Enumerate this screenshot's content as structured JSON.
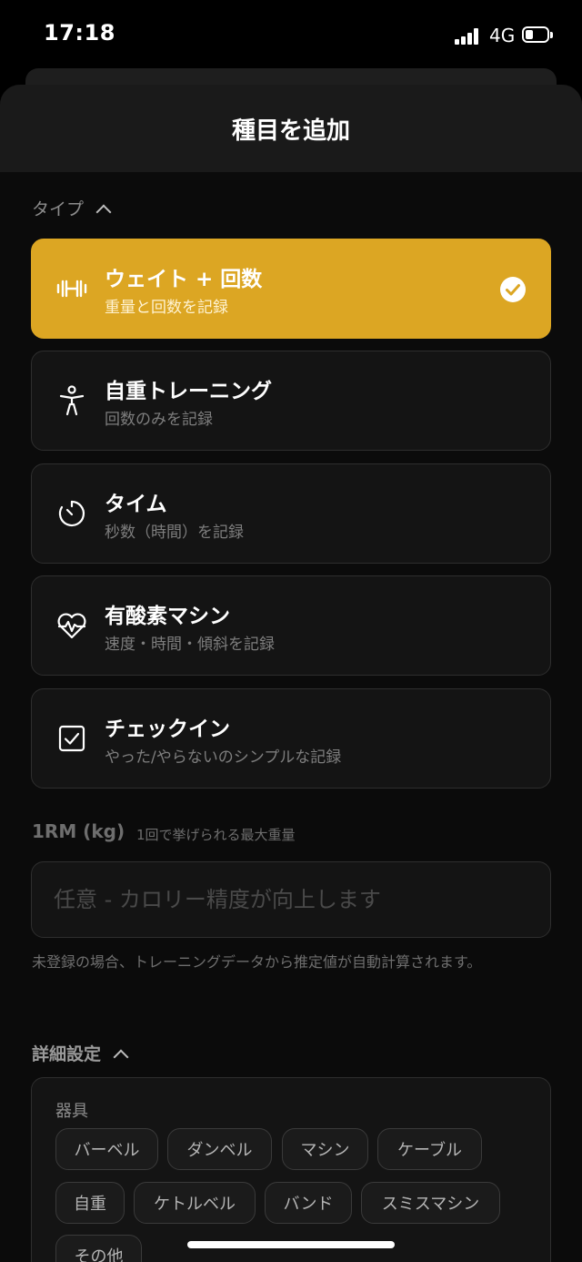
{
  "status": {
    "time": "17:18",
    "network": "4G"
  },
  "sheet": {
    "title": "種目を追加"
  },
  "type_section": {
    "label": "タイプ",
    "options": [
      {
        "title": "ウェイト + 回数",
        "description": "重量と回数を記録",
        "icon": "dumbbell-icon",
        "selected": true
      },
      {
        "title": "自重トレーニング",
        "description": "回数のみを記録",
        "icon": "person-icon",
        "selected": false
      },
      {
        "title": "タイム",
        "description": "秒数（時間）を記録",
        "icon": "timer-icon",
        "selected": false
      },
      {
        "title": "有酸素マシン",
        "description": "速度・時間・傾斜を記録",
        "icon": "heart-pulse-icon",
        "selected": false
      },
      {
        "title": "チェックイン",
        "description": "やった/やらないのシンプルな記録",
        "icon": "checkbox-icon",
        "selected": false
      }
    ]
  },
  "one_rm": {
    "label": "1RM (kg)",
    "sublabel": "1回で挙げられる最大重量",
    "value": "",
    "placeholder": "任意 - カロリー精度が向上します",
    "help": "未登録の場合、トレーニングデータから推定値が自動計算されます。"
  },
  "details": {
    "label": "詳細設定",
    "equipment_label": "器具",
    "equipment": [
      "バーベル",
      "ダンベル",
      "マシン",
      "ケーブル",
      "自重",
      "ケトルベル",
      "バンド",
      "スミスマシン",
      "その他"
    ]
  },
  "colors": {
    "accent": "#dca623",
    "card": "#141414",
    "background": "#0b0b0b"
  }
}
